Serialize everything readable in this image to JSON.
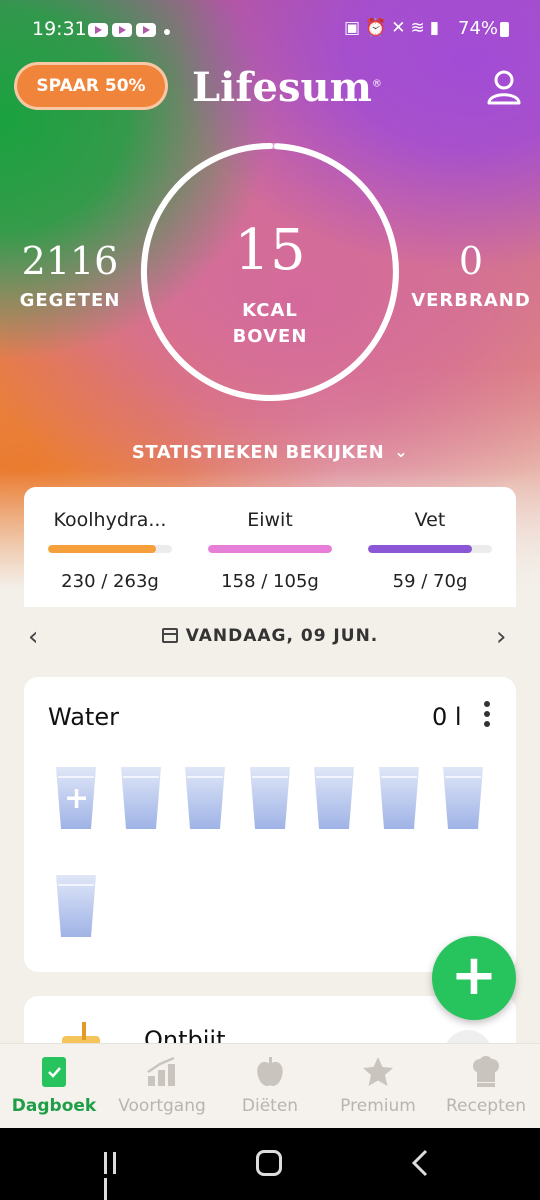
{
  "status_bar": {
    "time": "19:31",
    "battery": "74%"
  },
  "header": {
    "promo_label": "SPAAR 50%",
    "logo": "Lifesum",
    "logo_mark": "®"
  },
  "summary": {
    "eaten_value": "2116",
    "eaten_label": "GEGETEN",
    "remaining_value": "15",
    "remaining_label_line1": "KCAL",
    "remaining_label_line2": "BOVEN",
    "burned_value": "0",
    "burned_label": "VERBRAND",
    "ring_progress": 0.0
  },
  "stats_link": "STATISTIEKEN BEKIJKEN",
  "macros": [
    {
      "name": "Koolhydra...",
      "value": "230 / 263g",
      "progress": 0.87,
      "color": "#f5a03a"
    },
    {
      "name": "Eiwit",
      "value": "158 / 105g",
      "progress": 1.0,
      "color": "#e77fd8"
    },
    {
      "name": "Vet",
      "value": "59 / 70g",
      "progress": 0.84,
      "color": "#8b57d6"
    }
  ],
  "date_label": "VANDAAG, 09 JUN.",
  "water": {
    "title": "Water",
    "amount": "0 l",
    "glasses": 8
  },
  "meal": {
    "title": "Ontbijt"
  },
  "tabs": [
    {
      "label": "Dagboek",
      "icon": "diary-icon",
      "active": true
    },
    {
      "label": "Voortgang",
      "icon": "progress-chart-icon",
      "active": false
    },
    {
      "label": "Diëten",
      "icon": "apple-icon",
      "active": false
    },
    {
      "label": "Premium",
      "icon": "star-icon",
      "active": false
    },
    {
      "label": "Recepten",
      "icon": "chef-hat-icon",
      "active": false
    }
  ],
  "colors": {
    "accent": "#27c35c",
    "active_tab": "#1e9e46",
    "promo": "#f0843a"
  }
}
